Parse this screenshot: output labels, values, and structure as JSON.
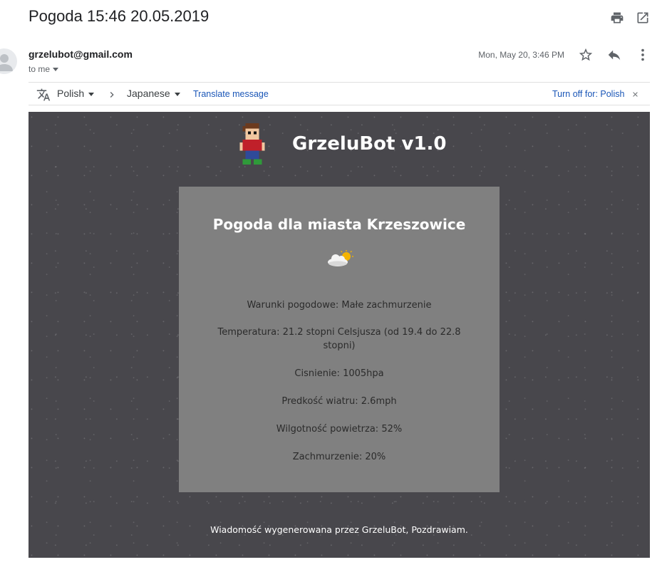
{
  "email": {
    "subject": "Pogoda 15:46 20.05.2019",
    "sender": "grzelubot@gmail.com",
    "recipient": "to me",
    "date": "Mon, May 20, 3:46 PM"
  },
  "translate_bar": {
    "source_language": "Polish",
    "target_language": "Japanese",
    "translate_link": "Translate message",
    "turn_off_link": "Turn off for: Polish"
  },
  "body": {
    "brand": "GrzeluBot v1.0",
    "card_title": "Pogoda dla miasta Krzeszowice",
    "lines": [
      "Warunki pogodowe: Małe zachmurzenie",
      "Temperatura: 21.2 stopni Celsjusza (od 19.4 do 22.8 stopni)",
      "Cisnienie: 1005hpa",
      "Predkość wiatru: 2.6mph",
      "Wilgotność powietrza: 52%",
      "Zachmurzenie: 20%"
    ],
    "footer": "Wiadomość wygenerowana przez GrzeluBot, Pozdrawiam."
  },
  "colors": {
    "body_bg": "#48474c",
    "card_bg": "#808080",
    "link": "#1a56b7"
  },
  "icons": [
    "print-icon",
    "open-new-window-icon",
    "star-icon",
    "reply-icon",
    "more-vert-icon",
    "translate-icon",
    "chevron-right-icon",
    "close-icon",
    "weather-partly-cloudy-icon",
    "mascot-image"
  ]
}
